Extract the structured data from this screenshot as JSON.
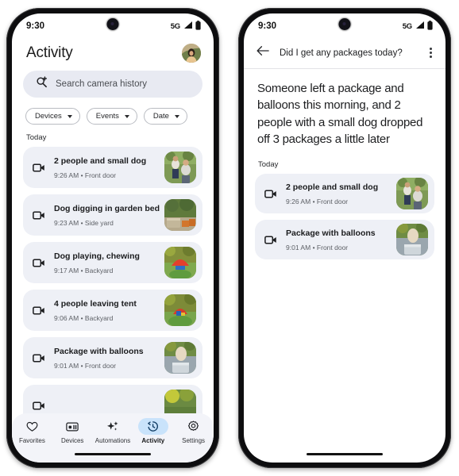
{
  "colors": {
    "accent": "#c9e3fb",
    "card_bg": "#eef0f6",
    "search_bg": "#e8eaf2",
    "nav_bg": "#f3f4f9",
    "text_primary": "#1b1c1e",
    "text_secondary": "#5d6066",
    "frame": "#0d0d0f"
  },
  "left_phone": {
    "status": {
      "time": "9:30",
      "network": "5G",
      "signal_icon": "signal-bars-icon",
      "battery_icon": "battery-full-icon",
      "camera_icon": "front-camera-punchhole"
    },
    "header": {
      "title": "Activity",
      "avatar_icon": "user-avatar"
    },
    "search": {
      "placeholder": "Search camera history",
      "icon": "search-sparkle-icon"
    },
    "filters": [
      {
        "label": "Devices",
        "icon": "chevron-down-icon"
      },
      {
        "label": "Events",
        "icon": "chevron-down-icon"
      },
      {
        "label": "Date",
        "icon": "chevron-down-icon"
      }
    ],
    "section_label": "Today",
    "events": [
      {
        "title": "2 people and small dog",
        "time": "9:26 AM",
        "separator": "•",
        "location": "Front door",
        "icon": "video-camera-icon",
        "thumb": "two-people-dog-garden"
      },
      {
        "title": "Dog digging in garden bed",
        "time": "9:23 AM",
        "separator": "•",
        "location": "Side yard",
        "icon": "video-camera-icon",
        "thumb": "garden-bed-hedge"
      },
      {
        "title": "Dog playing, chewing",
        "time": "9:17 AM",
        "separator": "•",
        "location": "Backyard",
        "icon": "video-camera-icon",
        "thumb": "dog-red-toy-lawn"
      },
      {
        "title": "4 people leaving tent",
        "time": "9:06 AM",
        "separator": "•",
        "location": "Backyard",
        "icon": "video-camera-icon",
        "thumb": "tent-on-lawn"
      },
      {
        "title": "Package with balloons",
        "time": "9:01 AM",
        "separator": "•",
        "location": "Front door",
        "icon": "video-camera-icon",
        "thumb": "package-balloons-porch"
      }
    ],
    "nav": [
      {
        "label": "Favorites",
        "icon": "heart-icon",
        "active": false
      },
      {
        "label": "Devices",
        "icon": "devices-icon",
        "active": false
      },
      {
        "label": "Automations",
        "icon": "sparkles-icon",
        "active": false
      },
      {
        "label": "Activity",
        "icon": "history-clock-icon",
        "active": true
      },
      {
        "label": "Settings",
        "icon": "gear-icon",
        "active": false
      }
    ]
  },
  "right_phone": {
    "status": {
      "time": "9:30",
      "network": "5G",
      "signal_icon": "signal-bars-icon",
      "battery_icon": "battery-full-icon",
      "camera_icon": "front-camera-punchhole"
    },
    "header": {
      "back_icon": "back-arrow-icon",
      "title": "Did I get any packages today?",
      "overflow_icon": "more-vertical-icon"
    },
    "answer": "Someone left a package and balloons this morning, and 2 people with a small dog dropped off 3 packages a little later",
    "section_label": "Today",
    "events": [
      {
        "title": "2 people and small dog",
        "time": "9:26 AM",
        "separator": "•",
        "location": "Front door",
        "icon": "video-camera-icon",
        "thumb": "two-people-dog-garden"
      },
      {
        "title": "Package with balloons",
        "time": "9:01 AM",
        "separator": "•",
        "location": "Front door",
        "icon": "video-camera-icon",
        "thumb": "package-balloons-porch"
      }
    ]
  }
}
